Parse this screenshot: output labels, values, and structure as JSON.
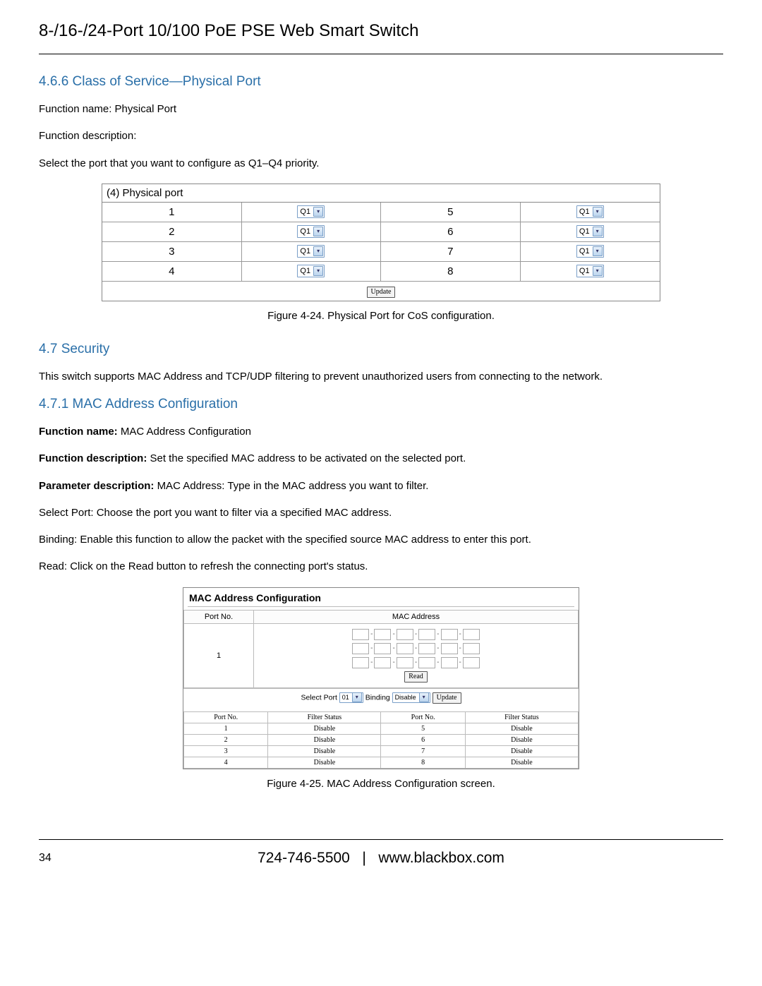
{
  "doc_title": "8-/16-/24-Port 10/100 PoE PSE Web Smart Switch",
  "sec_466": {
    "heading": "4.6.6 Class of Service—Physical Port",
    "fn_name": "Function name: Physical Port",
    "fn_desc": "Function description:",
    "select_text": "Select the port that you want to configure as Q1–Q4 priority."
  },
  "pp": {
    "title": "(4) Physical port",
    "ports_left": [
      "1",
      "2",
      "3",
      "4"
    ],
    "ports_right": [
      "5",
      "6",
      "7",
      "8"
    ],
    "select_value": "Q1",
    "update_label": "Update"
  },
  "fig1": "Figure 4-24. Physical Port for CoS configuration.",
  "sec_47": {
    "heading": "4.7 Security",
    "text": "This switch supports MAC Address and TCP/UDP filtering to prevent unauthorized users from connecting to the network."
  },
  "sec_471": {
    "heading": "4.7.1 MAC Address Configuration",
    "fn_name_label": "Function name: ",
    "fn_name_val": "MAC Address Configuration",
    "fn_desc_label": "Function description: ",
    "fn_desc_val": "Set the specified MAC address to be activated on the selected port.",
    "param_label": "Parameter description: ",
    "param_val": "MAC Address: Type in the MAC address you want to filter.",
    "select_port": "Select Port: Choose the port you want to filter via a specified MAC address.",
    "binding": "Binding: Enable this function to allow the packet with the specified source MAC address to enter this port.",
    "read": "Read: Click on the Read button to refresh the connecting port's status."
  },
  "mac": {
    "title": "MAC Address Configuration",
    "hdr_portno": "Port No.",
    "hdr_mac": "MAC Address",
    "port_val": "1",
    "read_btn": "Read",
    "ctrl_select_port": "Select Port",
    "ctrl_select_val": "01",
    "ctrl_binding": "Binding",
    "ctrl_binding_val": "Disable",
    "ctrl_update": "Update",
    "status_hdr": [
      "Port No.",
      "Filter Status",
      "Port No.",
      "Filter Status"
    ],
    "status_rows": [
      [
        "1",
        "Disable",
        "5",
        "Disable"
      ],
      [
        "2",
        "Disable",
        "6",
        "Disable"
      ],
      [
        "3",
        "Disable",
        "7",
        "Disable"
      ],
      [
        "4",
        "Disable",
        "8",
        "Disable"
      ]
    ]
  },
  "fig2": "Figure 4-25. MAC Address Configuration screen.",
  "footer": {
    "page_num": "34",
    "phone": "724-746-5500",
    "sep": "|",
    "url": "www.blackbox.com"
  }
}
